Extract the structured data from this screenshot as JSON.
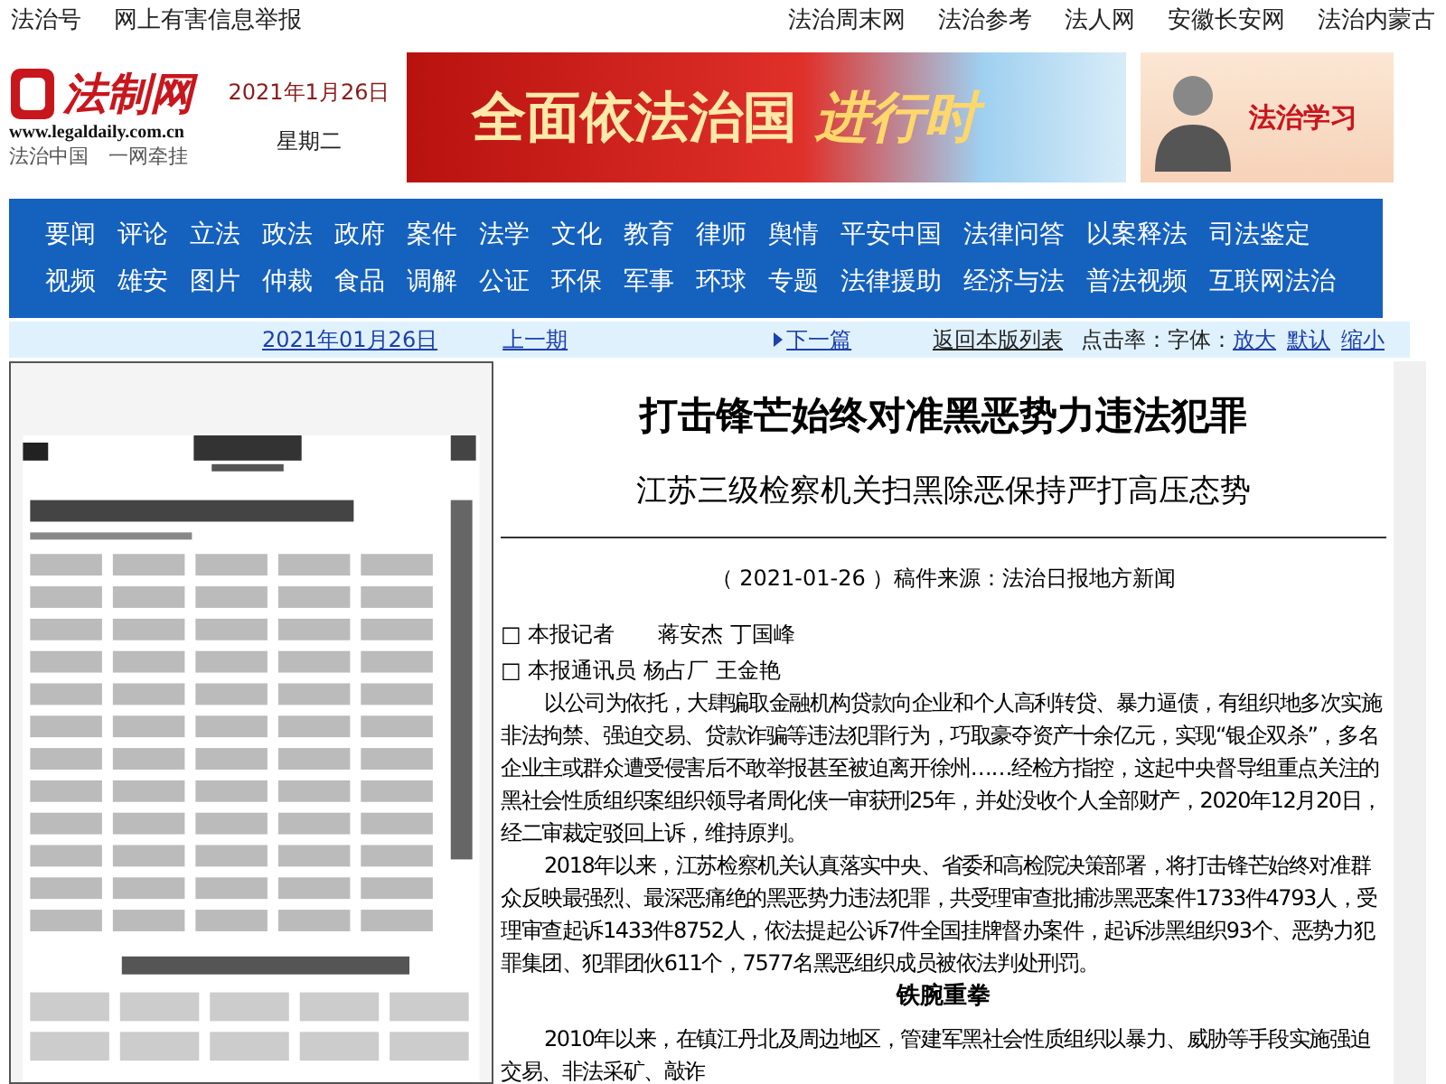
{
  "top_bar": {
    "left_links": [
      "法治号",
      "网上有害信息举报"
    ],
    "right_links": [
      "法治周末网",
      "法治参考",
      "法人网",
      "安徽长安网",
      "法治内蒙古"
    ]
  },
  "header": {
    "logo": {
      "name": "法制网",
      "url": "www.legaldaily.com.cn",
      "slogan": "法治中国　一网牵挂"
    },
    "date": "2021年1月26日",
    "weekday": "星期二",
    "banner": {
      "text": "全面依法治国",
      "accent": "进行时"
    },
    "promo": {
      "text": "法治学习"
    }
  },
  "nav": {
    "rows": [
      [
        "要闻",
        "评论",
        "立法",
        "政法",
        "政府",
        "案件",
        "法学",
        "文化",
        "教育",
        "律师",
        "舆情",
        "平安中国",
        "法律问答",
        "以案释法",
        "司法鉴定"
      ],
      [
        "视频",
        "雄安",
        "图片",
        "仲裁",
        "食品",
        "调解",
        "公证",
        "环保",
        "军事",
        "环球",
        "专题",
        "法律援助",
        "经济与法",
        "普法视频",
        "互联网法治"
      ]
    ]
  },
  "issue_bar": {
    "date_link": "2021年01月26日",
    "prev_link": "上一期",
    "next_link": "下一篇",
    "back_link": "返回本版列表",
    "clicks_label": "点击率：",
    "font_label": "字体：",
    "font_links": [
      "放大",
      "默认",
      "缩小"
    ]
  },
  "article": {
    "title": "打击锋芒始终对准黑恶势力违法犯罪",
    "subtitle": "江苏三级检察机关扫黑除恶保持严打高压态势",
    "meta": "（ 2021-01-26 ）稿件来源：法治日报地方新闻",
    "byline_marker": "□",
    "bylines": [
      "本报记者　　蒋安杰 丁国峰",
      "本报通讯员 杨占厂 王金艳"
    ],
    "blocks": [
      {
        "kind": "paragraph",
        "text": "以公司为依托，大肆骗取金融机构贷款向企业和个人高利转贷、暴力逼债，有组织地多次实施非法拘禁、强迫交易、贷款诈骗等违法犯罪行为，巧取豪夺资产十余亿元，实现“银企双杀”，多名企业主或群众遭受侵害后不敢举报甚至被迫离开徐州……经检方指控，这起中央督导组重点关注的黑社会性质组织案组织领导者周化侠一审获刑25年，并处没收个人全部财产，2020年12月20日，经二审裁定驳回上诉，维持原判。"
      },
      {
        "kind": "paragraph",
        "text": "2018年以来，江苏检察机关认真落实中央、省委和高检院决策部署，将打击锋芒始终对准群众反映最强烈、最深恶痛绝的黑恶势力违法犯罪，共受理审查批捕涉黑恶案件1733件4793人，受理审查起诉1433件8752人，依法提起公诉7件全国挂牌督办案件，起诉涉黑组织93个、恶势力犯罪集团、犯罪团伙611个，7577名黑恶组织成员被依法判处刑罚。"
      },
      {
        "kind": "heading",
        "text": "铁腕重拳"
      },
      {
        "kind": "paragraph",
        "text": "2010年以来，在镇江丹北及周边地区，管建军黑社会性质组织以暴力、威胁等手段实施强迫交易、非法采矿、敲诈"
      }
    ]
  }
}
